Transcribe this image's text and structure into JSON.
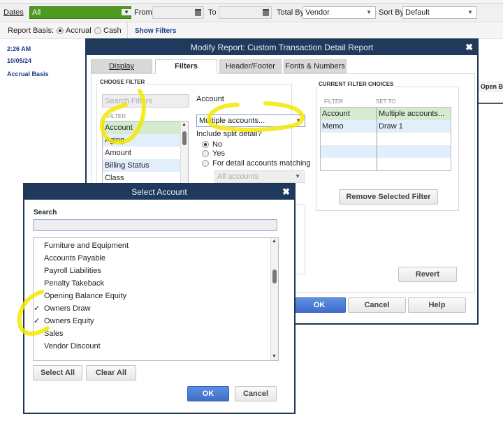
{
  "toolbar": {
    "dates_label": "Dates",
    "dates_value": "All",
    "from_label": "From",
    "to_label": "To",
    "total_by_label": "Total By",
    "total_by_value": "Vendor",
    "sort_by_label": "Sort By",
    "sort_by_value": "Default"
  },
  "basis": {
    "label": "Report Basis:",
    "accrual": "Accrual",
    "cash": "Cash",
    "show_filters": "Show Filters"
  },
  "report": {
    "time": "2:26 AM",
    "date": "10/05/24",
    "basis": "Accrual Basis",
    "column_partial": "Open B"
  },
  "modify_dialog": {
    "title": "Modify Report: Custom Transaction Detail Report",
    "tabs": [
      "Display",
      "Filters",
      "Header/Footer",
      "Fonts & Numbers"
    ],
    "choose_filter_label": "CHOOSE FILTER",
    "search_placeholder": "Search Filters",
    "filter_header": "FILTER",
    "filters": [
      "Account",
      "Aging",
      "Amount",
      "Billing Status",
      "Class"
    ],
    "account_label": "Account",
    "account_value": "Multiple accounts...",
    "split_label": "Include split detail?",
    "split_options": [
      "No",
      "Yes",
      "For detail accounts matching"
    ],
    "matching_value": "All accounts",
    "current_label": "CURRENT FILTER CHOICES",
    "current_headers": [
      "FILTER",
      "SET TO"
    ],
    "current_rows": [
      {
        "filter": "Account",
        "set_to": "Multiple accounts..."
      },
      {
        "filter": "Memo",
        "set_to": "Draw 1"
      }
    ],
    "remove_button": "Remove Selected Filter",
    "revert_button": "Revert",
    "ok_button": "OK",
    "cancel_button": "Cancel",
    "help_button": "Help"
  },
  "select_dialog": {
    "title": "Select Account",
    "search_label": "Search",
    "accounts": [
      {
        "name": "Furniture and Equipment",
        "checked": false
      },
      {
        "name": "Accounts Payable",
        "checked": false
      },
      {
        "name": "Payroll Liabilities",
        "checked": false
      },
      {
        "name": "Penalty Takeback",
        "checked": false
      },
      {
        "name": "Opening Balance Equity",
        "checked": false
      },
      {
        "name": "Owners Draw",
        "checked": true
      },
      {
        "name": "Owners Equity",
        "checked": true
      },
      {
        "name": "Sales",
        "checked": false
      },
      {
        "name": "Vendor Discount",
        "checked": false
      }
    ],
    "check_mark": "✓",
    "select_all": "Select All",
    "clear_all": "Clear All",
    "ok_button": "OK",
    "cancel_button": "Cancel"
  },
  "colors": {
    "title_bar": "#1f3a5c",
    "dates_green": "#4e9a1e",
    "highlight": "#f5e800",
    "selected_row": "#d4ebd0",
    "alt_row": "#e3eefc"
  }
}
